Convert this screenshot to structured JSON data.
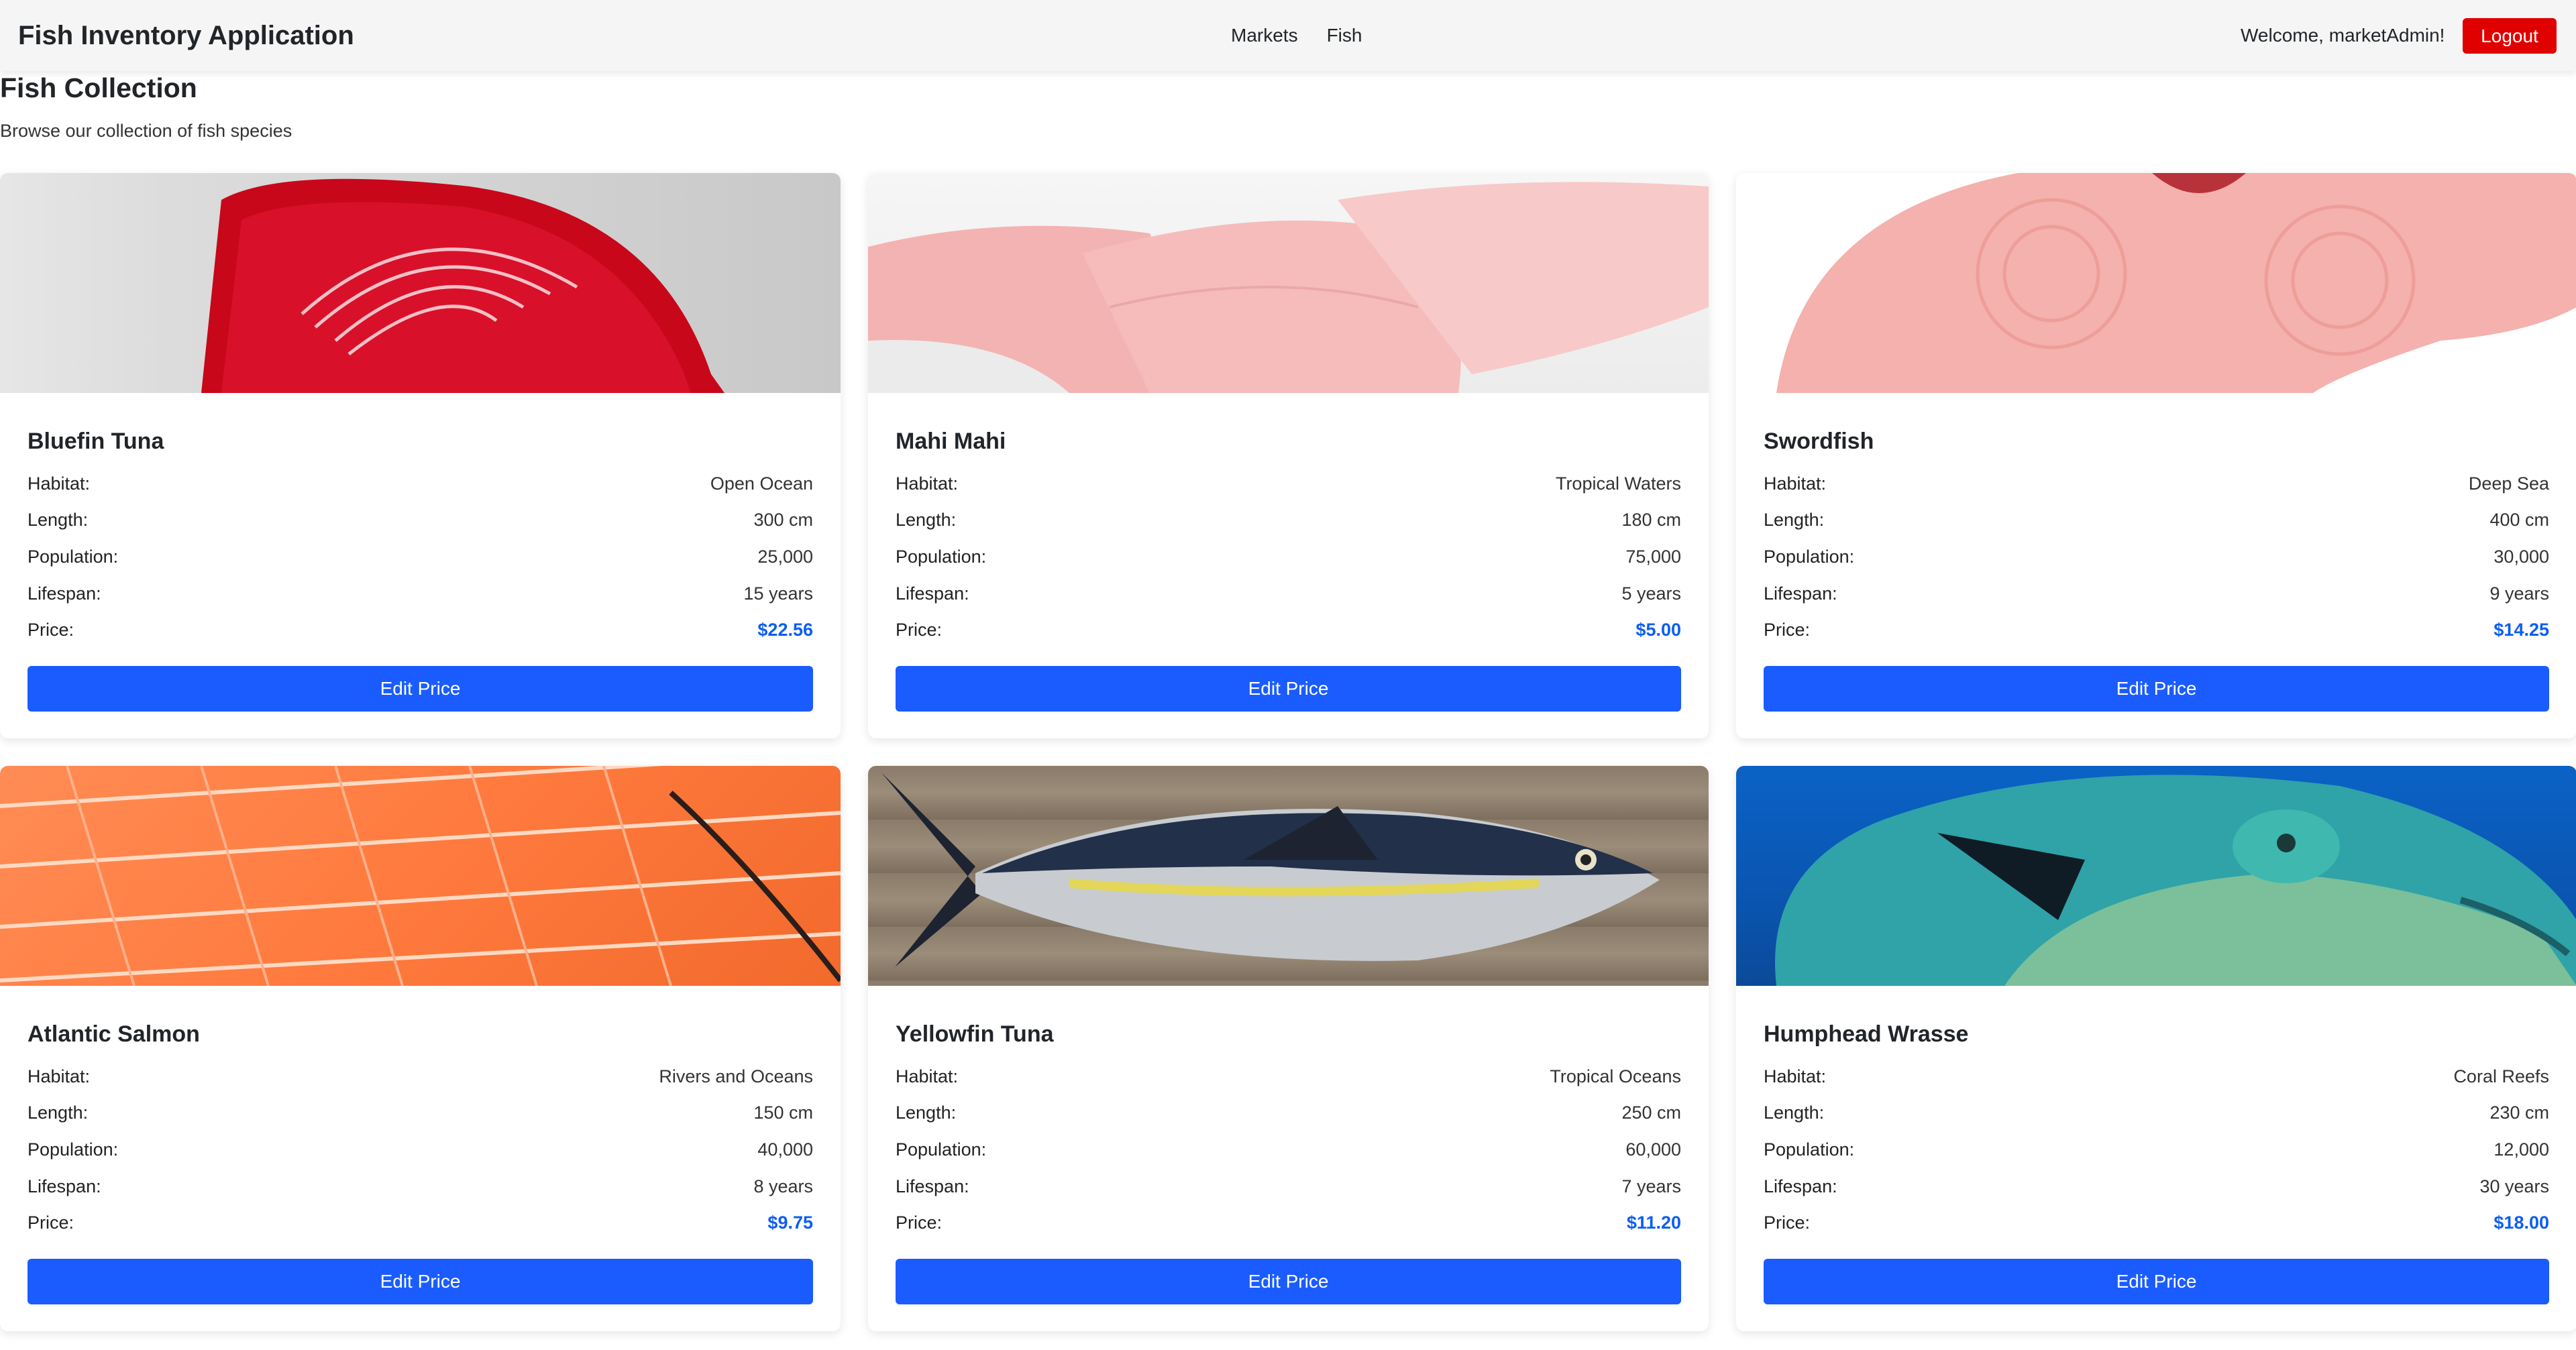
{
  "app": {
    "title": "Fish Inventory Application"
  },
  "nav": {
    "links": [
      "Markets",
      "Fish"
    ]
  },
  "user": {
    "welcome": "Welcome, marketAdmin!",
    "logout_label": "Logout"
  },
  "page": {
    "title": "Fish Collection",
    "subtitle": "Browse our collection of fish species"
  },
  "labels": {
    "habitat": "Habitat:",
    "length": "Length:",
    "population": "Population:",
    "lifespan": "Lifespan:",
    "price": "Price:",
    "edit_price": "Edit Price"
  },
  "fish": [
    {
      "name": "Bluefin Tuna",
      "habitat": "Open Ocean",
      "length": "300 cm",
      "population": "25,000",
      "lifespan": "15 years",
      "price": "$22.56"
    },
    {
      "name": "Mahi Mahi",
      "habitat": "Tropical Waters",
      "length": "180 cm",
      "population": "75,000",
      "lifespan": "5 years",
      "price": "$5.00"
    },
    {
      "name": "Swordfish",
      "habitat": "Deep Sea",
      "length": "400 cm",
      "population": "30,000",
      "lifespan": "9 years",
      "price": "$14.25"
    },
    {
      "name": "Atlantic Salmon",
      "habitat": "Rivers and Oceans",
      "length": "150 cm",
      "population": "40,000",
      "lifespan": "8 years",
      "price": "$9.75"
    },
    {
      "name": "Yellowfin Tuna",
      "habitat": "Tropical Oceans",
      "length": "250 cm",
      "population": "60,000",
      "lifespan": "7 years",
      "price": "$11.20"
    },
    {
      "name": "Humphead Wrasse",
      "habitat": "Coral Reefs",
      "length": "230 cm",
      "population": "12,000",
      "lifespan": "30 years",
      "price": "$18.00"
    }
  ],
  "colors": {
    "accent": "#1a5cff",
    "price": "#0d5ef2",
    "logout": "#e00000",
    "navbar": "#f5f5f5"
  }
}
